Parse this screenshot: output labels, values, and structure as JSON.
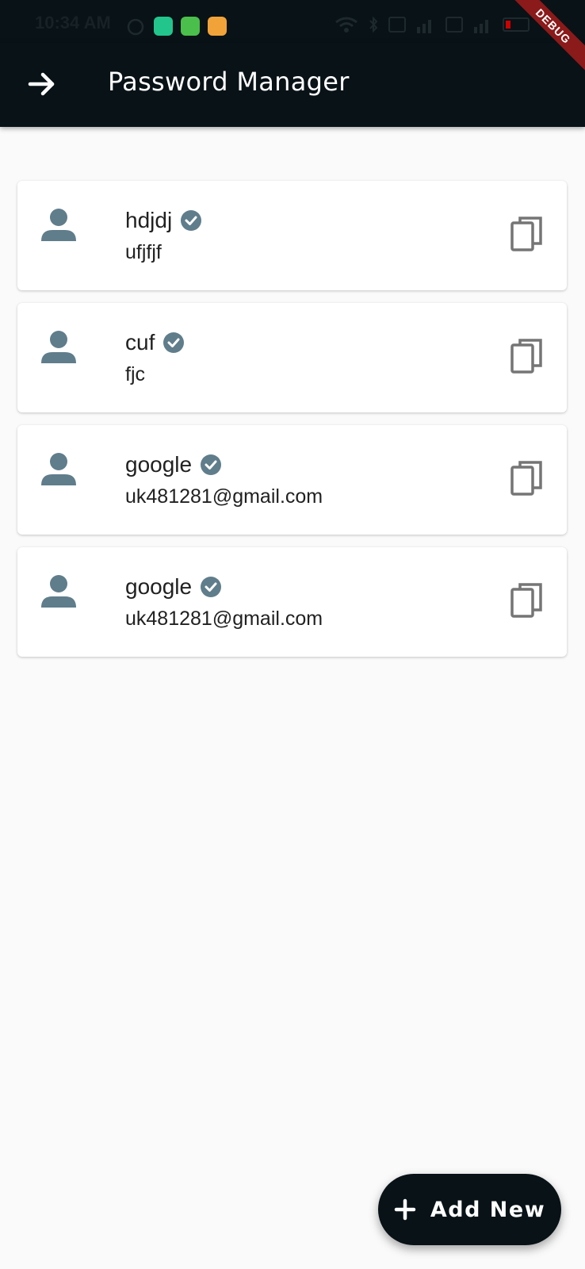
{
  "status_bar": {
    "time": "10:34 AM"
  },
  "app_bar": {
    "title": "Password Manager",
    "back_icon": "arrow-right-icon"
  },
  "debug_banner": "DEBUG",
  "entries": [
    {
      "name": "hdjdj",
      "subtitle": "ufjfjf"
    },
    {
      "name": "cuf",
      "subtitle": "fjc"
    },
    {
      "name": "google",
      "subtitle": "uk481281@gmail.com"
    },
    {
      "name": "google",
      "subtitle": "uk481281@gmail.com"
    }
  ],
  "fab": {
    "label": "Add New",
    "icon": "plus-icon"
  },
  "colors": {
    "appbar": "#081217",
    "icon_gray": "#607d8b",
    "copy_gray": "#757575",
    "background": "#fafafa"
  }
}
